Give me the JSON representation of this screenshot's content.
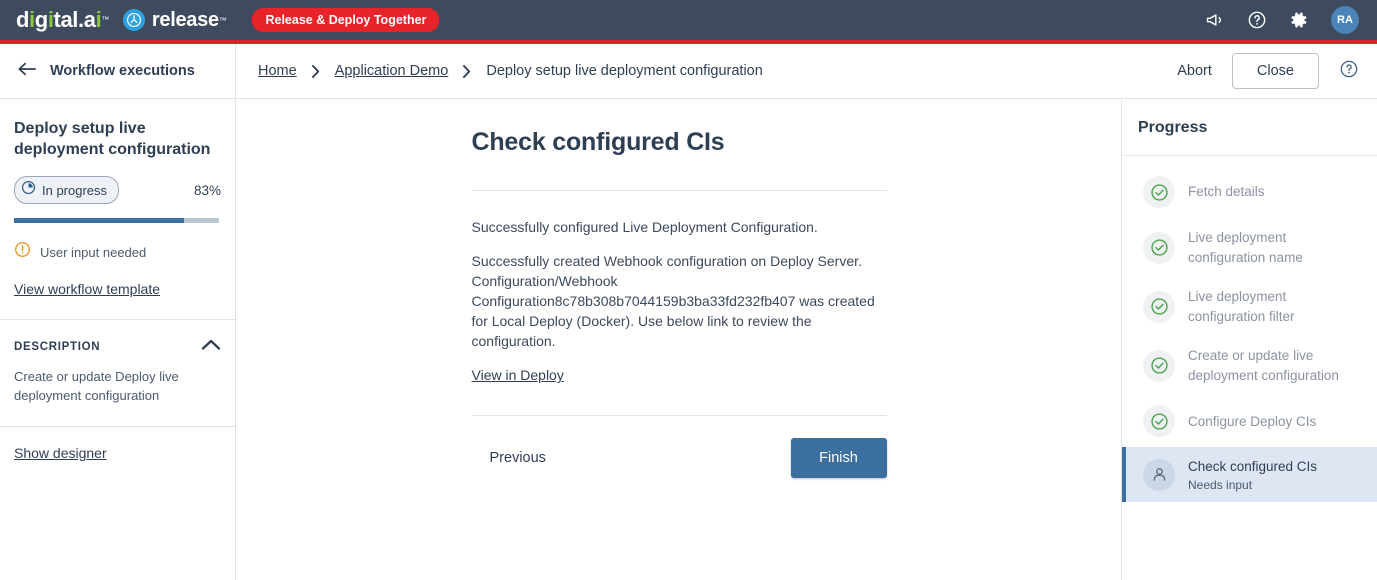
{
  "topbar": {
    "brand_primary": "digital.ai",
    "brand_tm": "™",
    "brand_secondary": "release",
    "promo_pill": "Release & Deploy Together",
    "icons": {
      "announcement": "megaphone-icon",
      "help": "help-circle-icon",
      "settings": "gear-icon"
    },
    "avatar_initials": "RA",
    "bar_color": "#3e4b5e",
    "accent_stripe_color": "#da2128",
    "pill_color": "#e8232a",
    "avatar_color": "#4a84b8"
  },
  "subbar": {
    "back_label": "Workflow executions",
    "breadcrumbs": [
      {
        "label": "Home",
        "current": false
      },
      {
        "label": "Application Demo",
        "current": false
      },
      {
        "label": "Deploy setup live deployment configuration",
        "current": true
      }
    ],
    "abort_label": "Abort",
    "close_label": "Close"
  },
  "sidebar": {
    "title": "Deploy setup live deployment configuration",
    "status_label": "In progress",
    "percent_label": "83%",
    "percent_value": 83,
    "note": "User input needed",
    "template_link": "View workflow template",
    "description_heading": "DESCRIPTION",
    "description_body": "Create or update Deploy live deployment configuration",
    "show_designer_link": "Show designer",
    "progress_fill_color": "#3a6f9f",
    "progress_track_color": "#b8c6d4",
    "warning_color": "#f08c1e"
  },
  "main": {
    "title": "Check configured CIs",
    "paragraphs": [
      "Successfully configured Live Deployment Configuration.",
      "Successfully created Webhook configuration on Deploy Server. Configuration/Webhook Configuration8c78b308b7044159b3ba33fd232fb407 was created for Local Deploy (Docker). Use below link to review the configuration."
    ],
    "deploy_link": "View in Deploy",
    "previous_label": "Previous",
    "finish_label": "Finish",
    "finish_color": "#3a6f9f"
  },
  "progress_panel": {
    "title": "Progress",
    "items": [
      {
        "label": "Fetch details",
        "state": "done",
        "sub": ""
      },
      {
        "label": "Live deployment configuration name",
        "state": "done",
        "sub": ""
      },
      {
        "label": "Live deployment configuration filter",
        "state": "done",
        "sub": ""
      },
      {
        "label": "Create or update live deployment configuration",
        "state": "done",
        "sub": ""
      },
      {
        "label": "Configure Deploy CIs",
        "state": "done",
        "sub": ""
      },
      {
        "label": "Check configured CIs",
        "state": "active",
        "sub": "Needs input"
      }
    ],
    "done_color": "#4ca54c",
    "active_bg": "#dde6f2",
    "active_accent": "#3a6f9f"
  }
}
